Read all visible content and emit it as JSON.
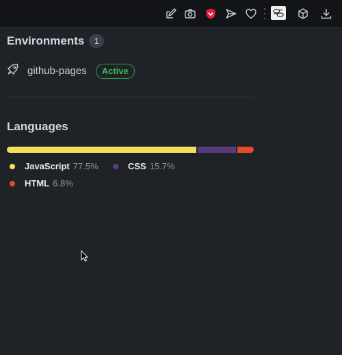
{
  "toolbar": {
    "icons": [
      "edit-icon",
      "camera-icon",
      "shield-icon",
      "send-icon",
      "heart-icon",
      "extension-icon",
      "cube-icon",
      "download-icon"
    ],
    "shield_color": "#e5213a"
  },
  "environments": {
    "title": "Environments",
    "count": "1",
    "items": [
      {
        "name": "github-pages",
        "status": "Active"
      }
    ]
  },
  "languages": {
    "title": "Languages",
    "items": [
      {
        "name": "JavaScript",
        "percent": "77.5%",
        "value": 77.5,
        "color": "#f1e05a"
      },
      {
        "name": "CSS",
        "percent": "15.7%",
        "value": 15.7,
        "color": "#563d7c"
      },
      {
        "name": "HTML",
        "percent": "6.8%",
        "value": 6.8,
        "color": "#e34c26"
      }
    ]
  }
}
